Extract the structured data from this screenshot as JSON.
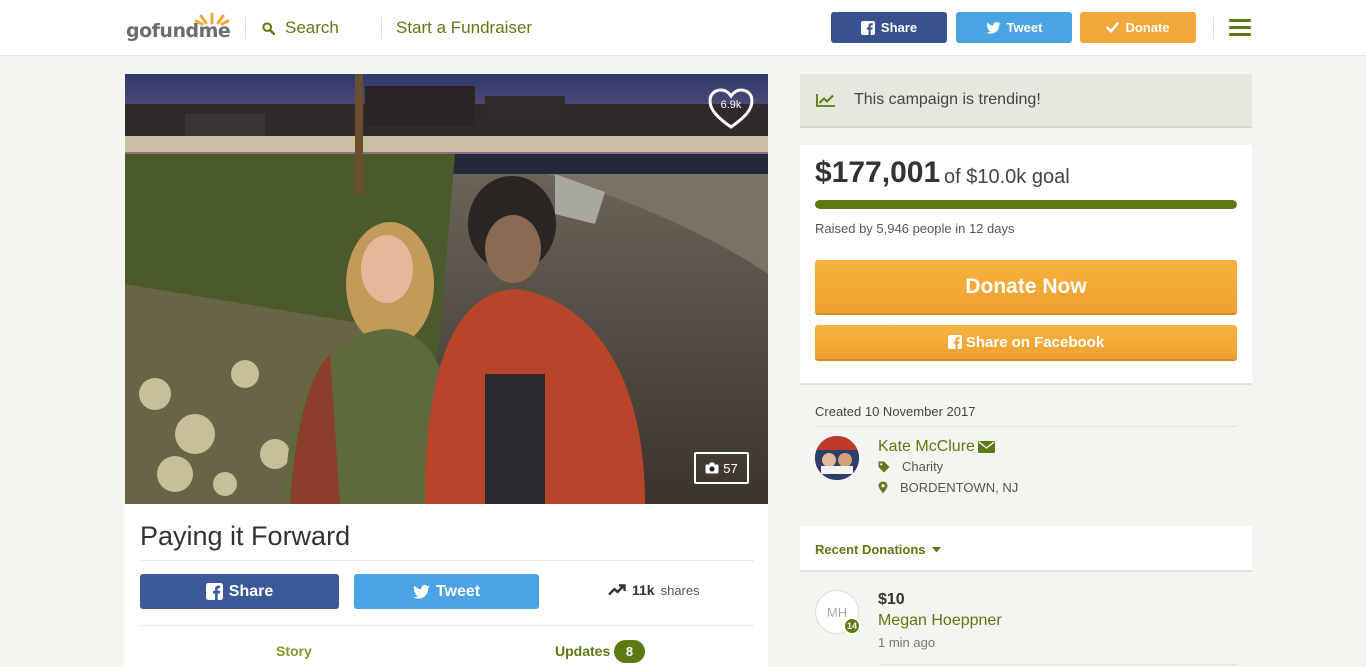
{
  "header": {
    "logo_text_a": "gofund",
    "logo_text_b": "me",
    "search_label": "Search",
    "start_label": "Start a Fundraiser",
    "share_label": "Share",
    "tweet_label": "Tweet",
    "donate_label": "Donate"
  },
  "hero": {
    "hearts": "6.9k",
    "photo_count": "57"
  },
  "campaign": {
    "title": "Paying it Forward",
    "share_label": "Share",
    "tweet_label": "Tweet",
    "shares_count": "11k",
    "shares_label": "shares",
    "tabs": [
      {
        "label": "Story"
      },
      {
        "label": "Updates",
        "count": "8"
      }
    ]
  },
  "sidebar": {
    "trending_text": "This campaign is trending!",
    "raised": "$177,001",
    "goal_text": "of $10.0k goal",
    "progress_fraction": 1.0,
    "raised_by": "Raised by 5,946 people in 12 days",
    "donate_now_label": "Donate Now",
    "share_facebook_label": "Share on Facebook",
    "created": "Created 10 November 2017",
    "organizer": {
      "name": "Kate McClure",
      "category": "Charity",
      "location": "BORDENTOWN, NJ"
    },
    "recent_donations_label": "Recent Donations",
    "donations": [
      {
        "initials": "MH",
        "badge": "14",
        "amount": "$10",
        "name": "Megan Hoeppner",
        "time": "1 min ago"
      }
    ]
  },
  "colors": {
    "brand_green": "#5b7a12",
    "facebook_blue": "#3b5998",
    "twitter_blue": "#4aa3e2",
    "donate_orange": "#f2a73a"
  },
  "icons": [
    "search-icon",
    "facebook-icon",
    "twitter-icon",
    "check-icon",
    "hamburger-icon",
    "heart-icon",
    "camera-icon",
    "trending-icon",
    "envelope-icon",
    "tag-icon",
    "location-pin-icon",
    "caret-down-icon"
  ]
}
